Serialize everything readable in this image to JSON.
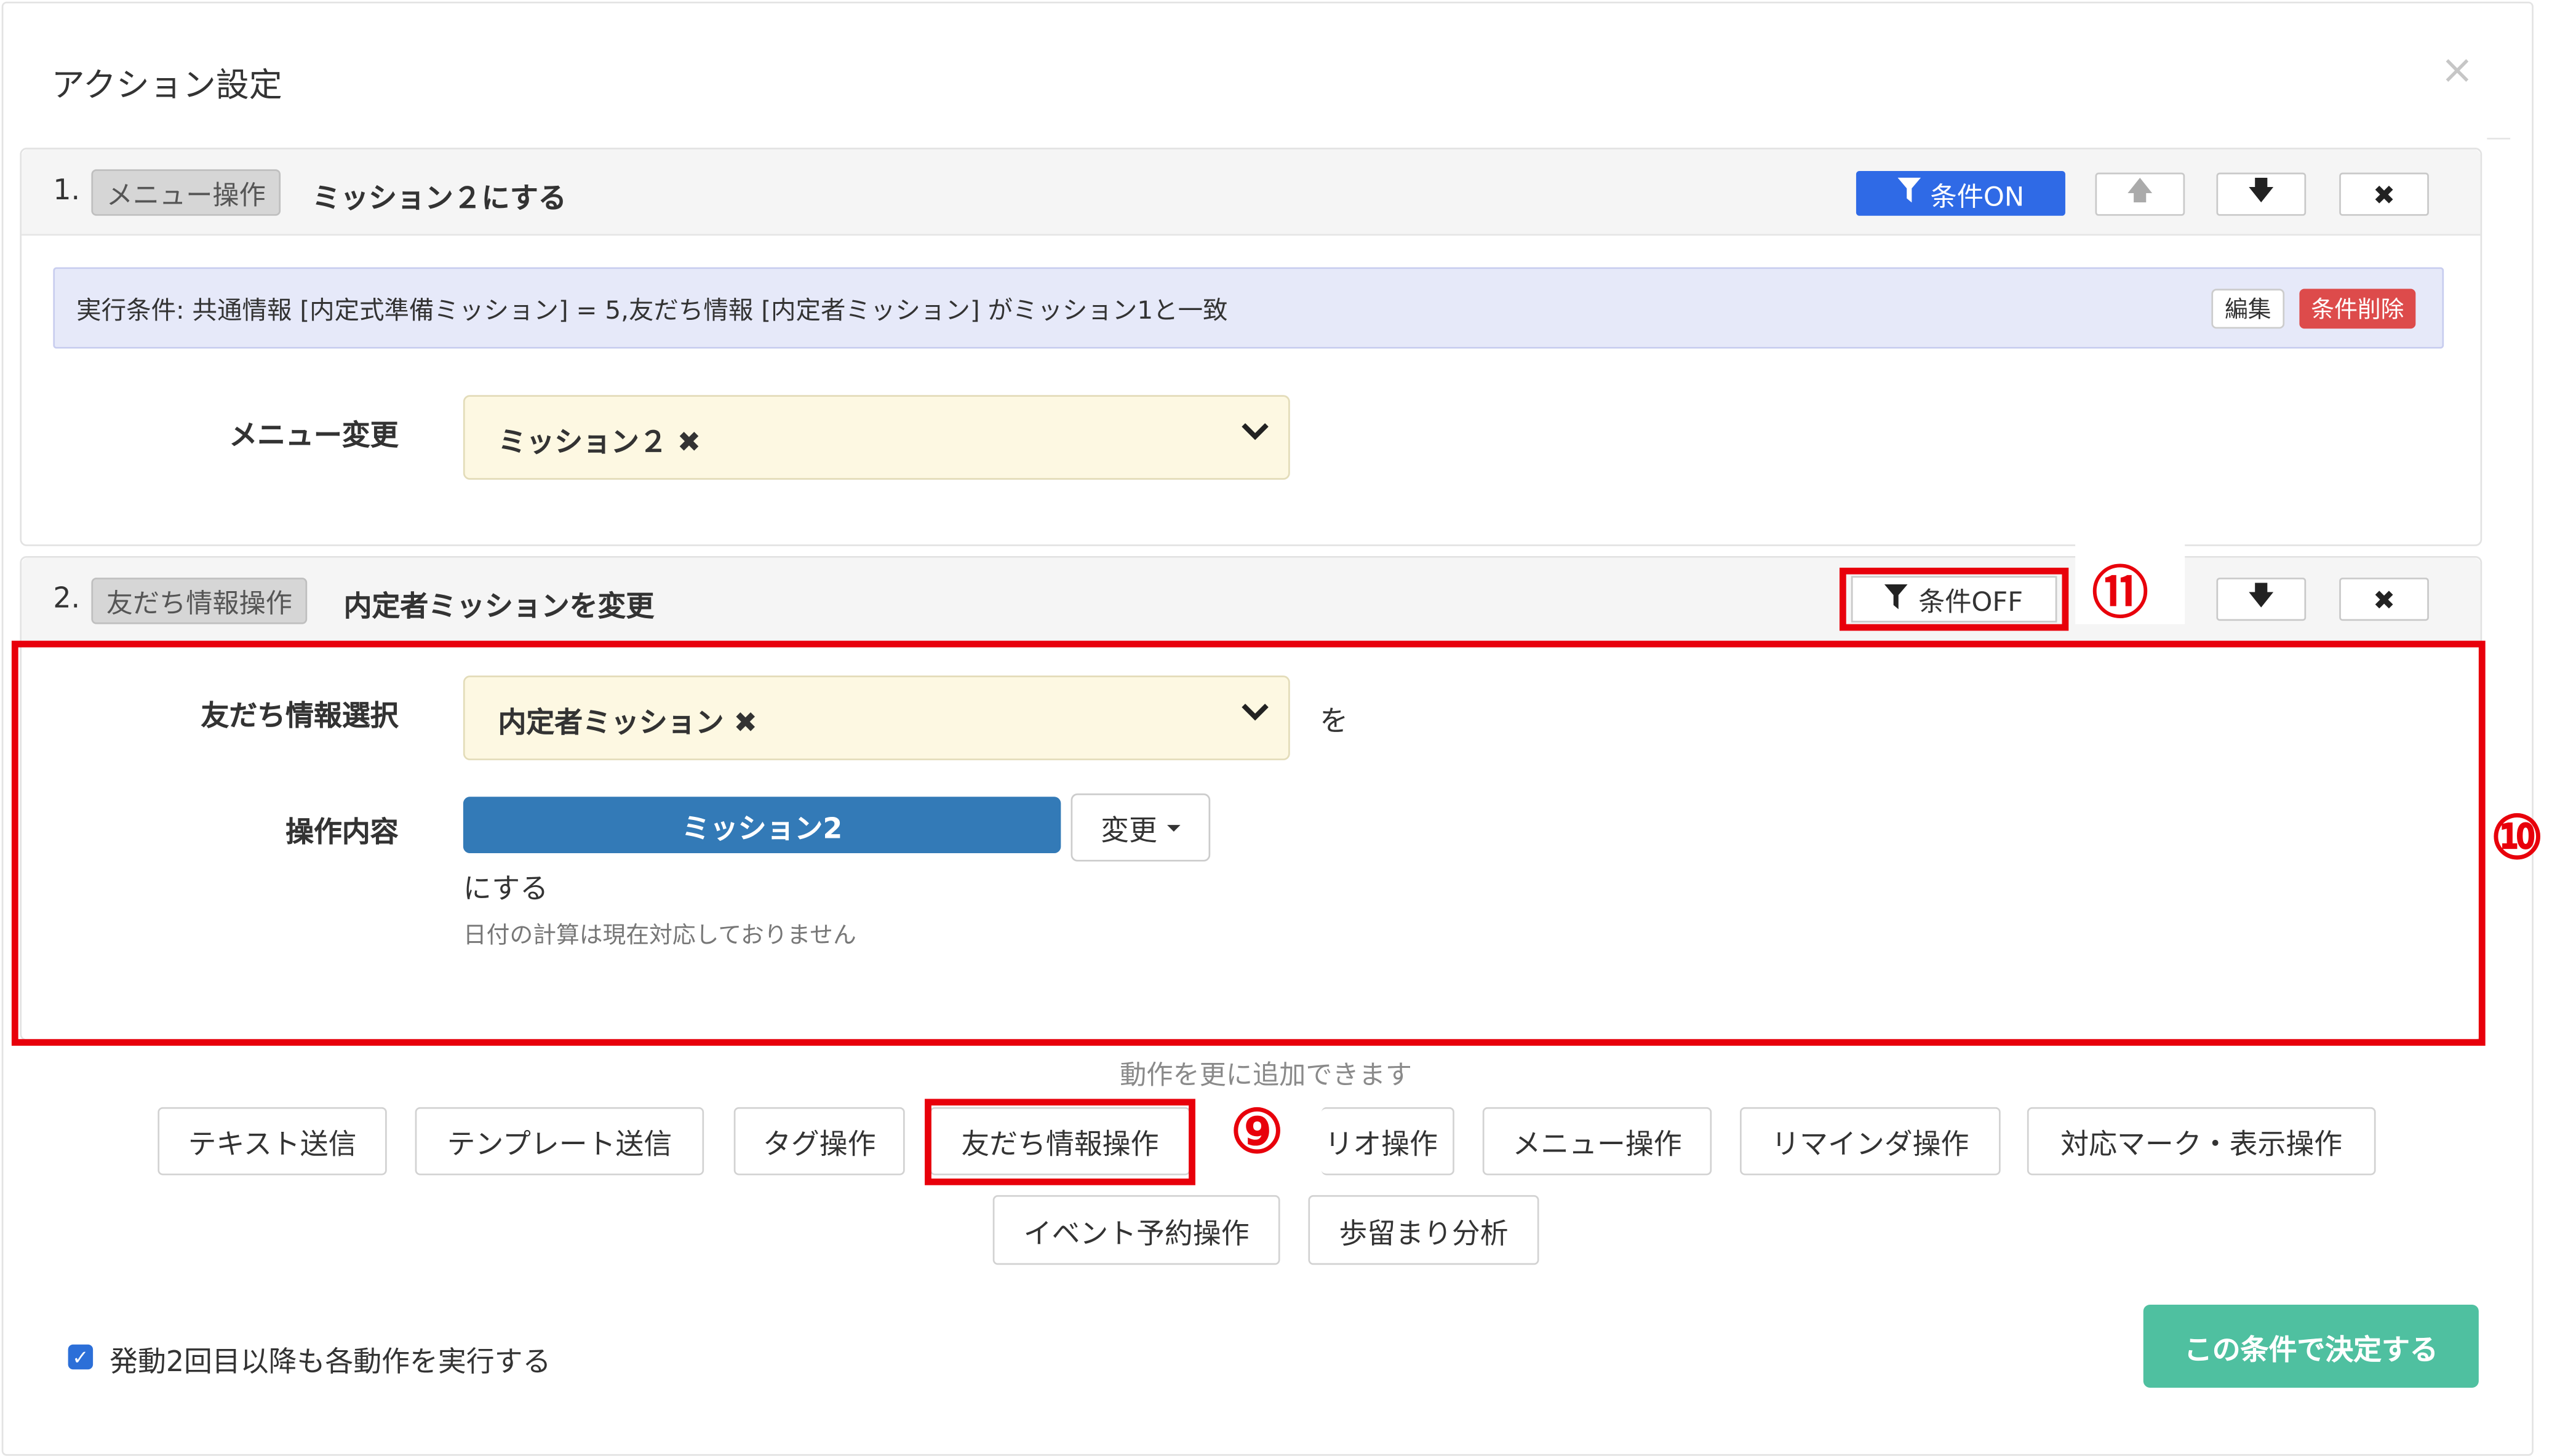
{
  "dialog": {
    "title": "アクション設定"
  },
  "action1": {
    "number": "1.",
    "type_label": "メニュー操作",
    "title": "ミッション２にする",
    "condition_button": "条件ON",
    "condition_text": "実行条件: 共通情報 [内定式準備ミッション] = 5,友だち情報 [内定者ミッション] がミッション1と一致",
    "edit_button": "編集",
    "delete_condition_button": "条件削除",
    "menu_change_label": "メニュー変更",
    "menu_change_value": "ミッション２ ✖"
  },
  "action2": {
    "number": "2.",
    "type_label": "友だち情報操作",
    "title": "内定者ミッションを変更",
    "condition_button": "条件OFF",
    "friend_info_label": "友だち情報選択",
    "friend_info_value": "内定者ミッション ✖",
    "particle_wo": "を",
    "operation_label": "操作内容",
    "operation_value": "ミッション2",
    "change_button": "変更",
    "suffix_text": "にする",
    "note_text": "日付の計算は現在対応しておりません"
  },
  "annotations": {
    "n9": "⑨",
    "n10": "⑩",
    "n11": "⑪"
  },
  "add_actions": {
    "hint": "動作を更に追加できます",
    "buttons_row1": [
      "テキスト送信",
      "テンプレート送信",
      "タグ操作",
      "友だち情報操作",
      "リオ操作",
      "メニュー操作",
      "リマインダ操作",
      "対応マーク・表示操作"
    ],
    "buttons_row2": [
      "イベント予約操作",
      "歩留まり分析"
    ]
  },
  "footer": {
    "repeat_checkbox_label": "発動2回目以降も各動作を実行する",
    "repeat_checked": true,
    "confirm_button": "この条件で決定する"
  },
  "colors": {
    "condition_on": "#2f6ae6",
    "annotation_red": "#e8000b",
    "confirm_green": "#4fc0a0",
    "operation_blue": "#337ab7",
    "delete_red": "#dd4b4b"
  }
}
